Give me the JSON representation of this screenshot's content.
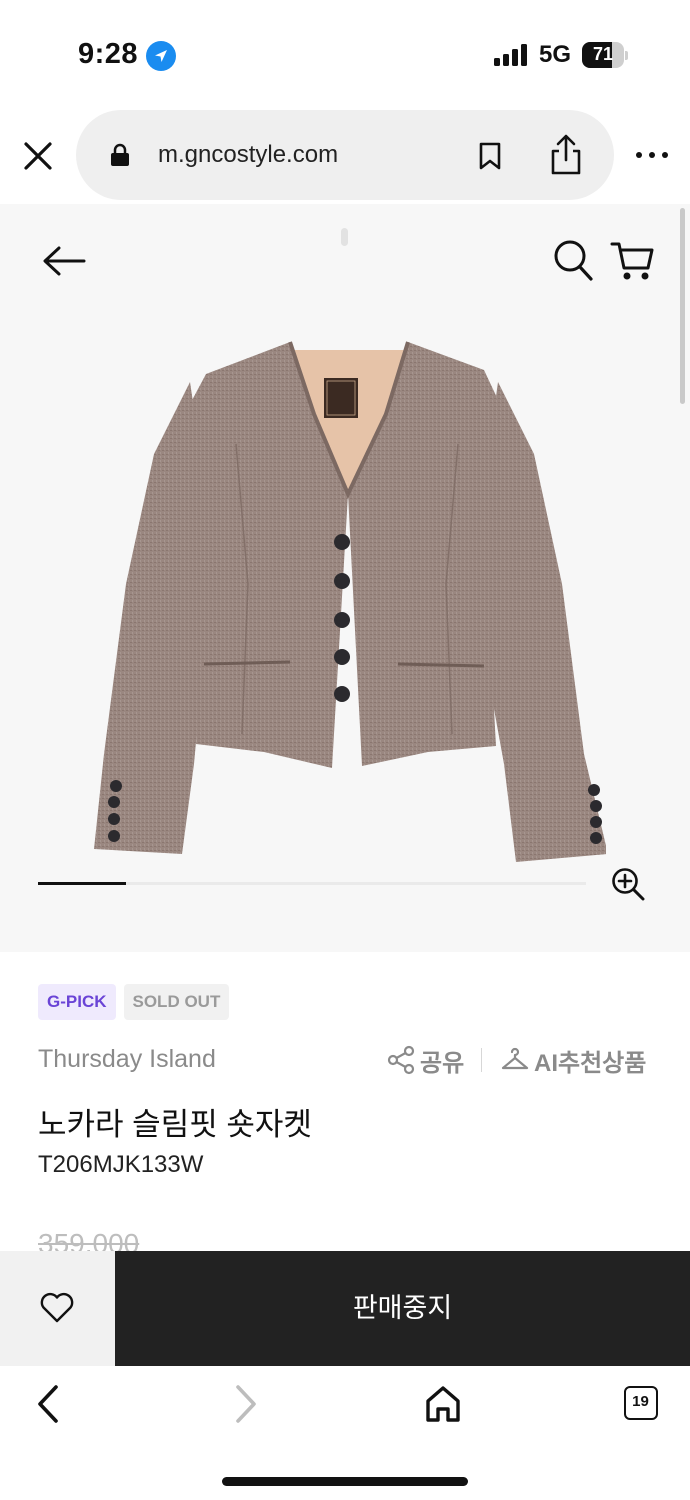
{
  "status_bar": {
    "time": "9:28",
    "network": "5G",
    "battery": "71",
    "battery_level": 0.71
  },
  "browser": {
    "url": "m.gncostyle.com",
    "tab_count": "19"
  },
  "gallery": {
    "slide_progress": 0.16
  },
  "product": {
    "badges": [
      "G-PICK",
      "SOLD OUT"
    ],
    "brand": "Thursday Island",
    "share_label": "공유",
    "ai_label": "AI추천상품",
    "name": "노카라 슬림핏 숏자켓",
    "code": "T206MJK133W",
    "price": "359,000"
  },
  "purchase_bar": {
    "status_label": "판매중지"
  },
  "colors": {
    "badge_purple": "#6a44d6",
    "dark_bar": "#222222",
    "location_blue": "#1a8cf0"
  }
}
